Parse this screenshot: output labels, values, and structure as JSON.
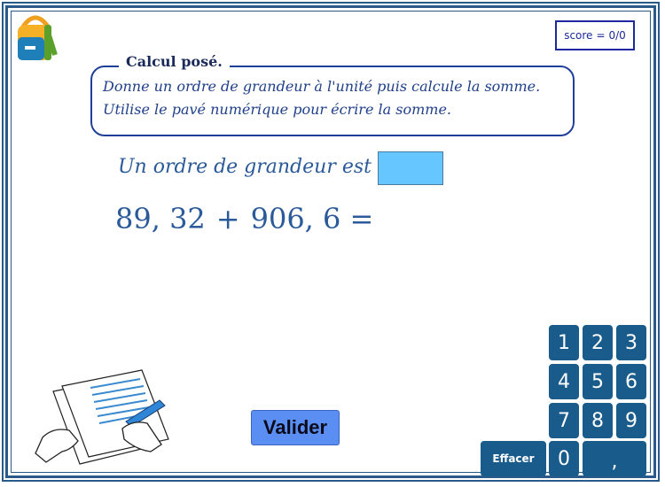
{
  "frame": {
    "border_color": "#2a5a8a"
  },
  "score": {
    "label": "score",
    "separator": "=",
    "value": "0/0"
  },
  "instructions": {
    "title": "Calcul posé.",
    "line1": "Donne un ordre de grandeur à l'unité puis calcule la somme.",
    "line2": "Utilise le pavé numérique pour écrire la somme."
  },
  "estimate": {
    "label": "Un ordre de grandeur est",
    "value": ""
  },
  "equation": {
    "operand1": "89, 32",
    "operator": "+",
    "operand2": "906, 6",
    "equals": "="
  },
  "validate_label": "Valider",
  "keypad": {
    "k1": "1",
    "k2": "2",
    "k3": "3",
    "k4": "4",
    "k5": "5",
    "k6": "6",
    "k7": "7",
    "k8": "8",
    "k9": "9",
    "k0": "0",
    "comma": ",",
    "clear": "Effacer"
  },
  "colors": {
    "accent": "#195c8c",
    "input_bg": "#66c6ff",
    "button_bg": "#5a8ef2",
    "text": "#2a5a9a"
  },
  "icons": [
    "backpack-icon",
    "writing-hands-illustration"
  ]
}
